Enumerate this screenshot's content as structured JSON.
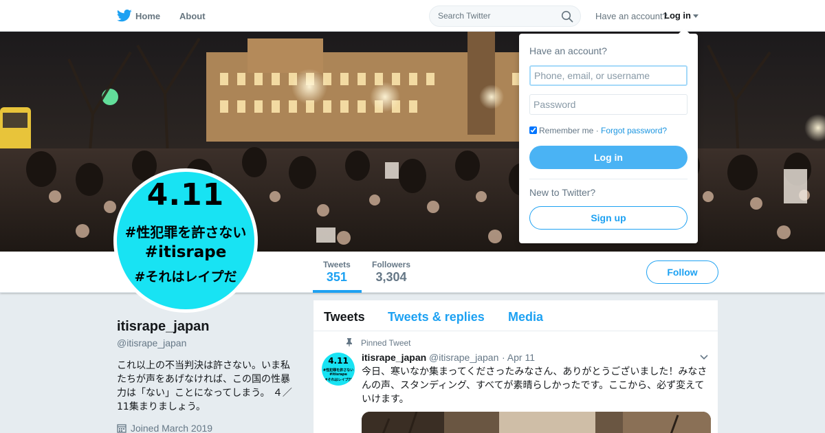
{
  "nav": {
    "home_label": "Home",
    "about_label": "About",
    "search_placeholder": "Search Twitter",
    "have_account": "Have an account?",
    "login_label": "Log in"
  },
  "avatar": {
    "big": "4.11",
    "line1": "#性犯罪を許さない",
    "line2": "#itisrape",
    "line3": "#それはレイプだ"
  },
  "stats": [
    {
      "label": "Tweets",
      "value": "351"
    },
    {
      "label": "Followers",
      "value": "3,304"
    }
  ],
  "follow_label": "Follow",
  "profile": {
    "name": "itisrape_japan",
    "handle": "@itisrape_japan",
    "bio": "これ以上の不当判決は許さない。いま私たちが声をあげなければ、この国の性暴力は「ない」ことになってしまう。 ４／11集まりましょう。",
    "joined": "Joined March 2019"
  },
  "timeline": {
    "tabs": [
      "Tweets",
      "Tweets & replies",
      "Media"
    ],
    "pinned_label": "Pinned Tweet",
    "tweet": {
      "name": "itisrape_japan",
      "handle": "@itisrape_japan",
      "date": "· Apr 11",
      "text": "今日、寒いなか集まってくださったみなさん、ありがとうございました！みなさんの声、スタンディング、すべてが素晴らしかったです。ここから、必ず変えていけます。"
    }
  },
  "login_dropdown": {
    "title": "Have an account?",
    "username_placeholder": "Phone, email, or username",
    "password_placeholder": "Password",
    "remember_label": "Remember me",
    "separator": "·",
    "forgot_label": "Forgot password?",
    "login_button": "Log in",
    "new_label": "New to Twitter?",
    "signup_button": "Sign up"
  },
  "colors": {
    "brand": "#1da1f2",
    "avatar_bg": "#18e3f3",
    "page_bg": "#e6ecf0"
  },
  "icons": [
    "twitter-bird-icon",
    "search-icon",
    "caret-down-icon",
    "pin-icon",
    "calendar-icon",
    "chevron-down-icon"
  ]
}
